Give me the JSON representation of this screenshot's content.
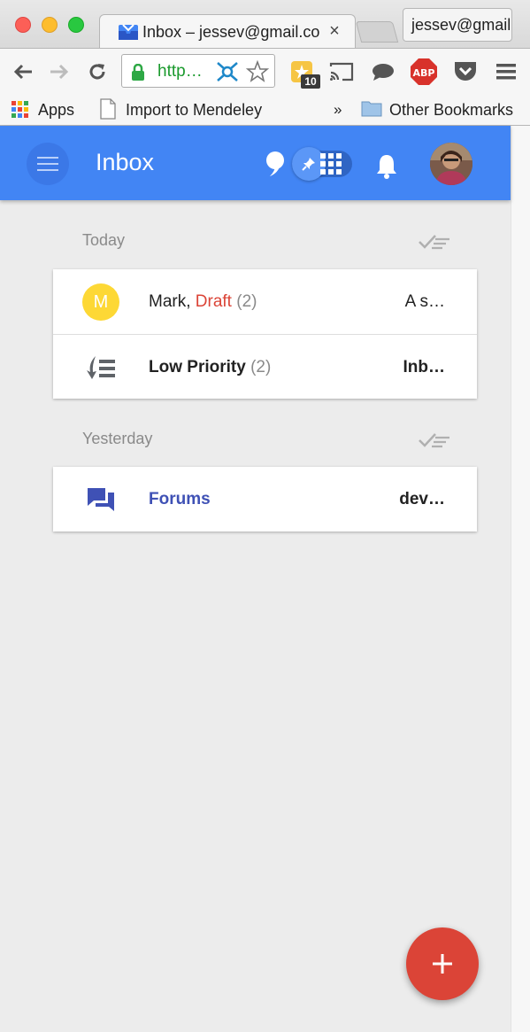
{
  "browser": {
    "tab": {
      "title": "Inbox – jessev@gmail.com",
      "close_glyph": "×",
      "favicon": "inbox-icon"
    },
    "profile_label": "jessev@gmail",
    "toolbar": {
      "back": "back-arrow-icon",
      "forward": "forward-arrow-icon",
      "reload": "reload-icon",
      "url": "http…",
      "extension_badge": "10",
      "abp_label": "ABP"
    },
    "bookmarks": {
      "apps_label": "Apps",
      "mendeley_label": "Import to Mendeley",
      "overflow_glyph": "»",
      "other_label": "Other Bookmarks"
    }
  },
  "app": {
    "title": "Inbox",
    "accent_color": "#4285f4",
    "sections": [
      {
        "header": "Today",
        "rows": [
          {
            "sender": "Mark,",
            "draft": "Draft",
            "count": "(2)",
            "snippet": "A s…",
            "avatar_letter": "M"
          },
          {
            "sender": "Low Priority",
            "count": "(2)",
            "snippet": "Inb…"
          }
        ]
      },
      {
        "header": "Yesterday",
        "rows": [
          {
            "sender": "Forums",
            "snippet": "dev…"
          }
        ]
      }
    ],
    "fab_glyph": "+"
  }
}
